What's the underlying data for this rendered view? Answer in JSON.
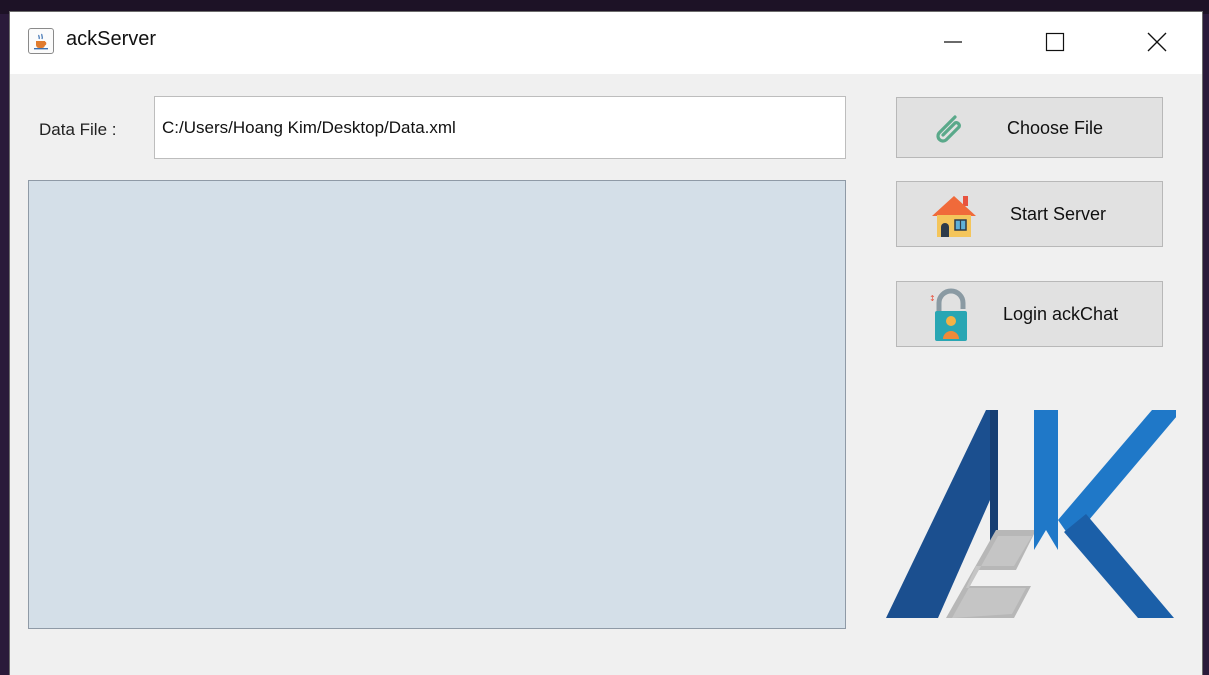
{
  "window": {
    "title": "ackServer",
    "app_icon": "java-cup-icon",
    "controls": [
      "minimize-icon",
      "maximize-icon",
      "close-icon"
    ]
  },
  "form": {
    "data_file_label": "Data File :",
    "data_file_value": "C:/Users/Hoang Kim/Desktop/Data.xml"
  },
  "log": {
    "content": ""
  },
  "buttons": {
    "choose_file": {
      "label": "Choose File",
      "icon": "paperclip-icon"
    },
    "start_server": {
      "label": "Start Server",
      "icon": "house-icon"
    },
    "login_ackchat": {
      "label": "Login ackChat",
      "icon": "padlock-user-icon"
    }
  },
  "logo": {
    "name": "ak-logo",
    "colors": {
      "dark_blue": "#1b4f8f",
      "blue": "#1f78c8",
      "gray": "#b7b7b7"
    }
  },
  "colors": {
    "window_bg": "#f0f0f0",
    "log_bg": "#d4dfe8",
    "button_bg": "#e1e1e1"
  }
}
